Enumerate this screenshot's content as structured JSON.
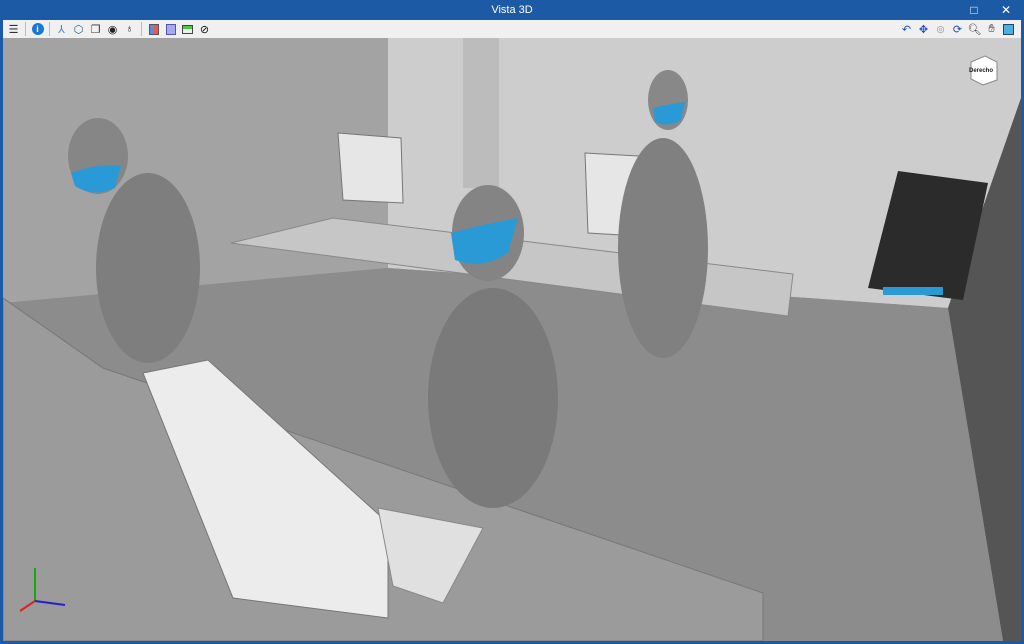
{
  "window": {
    "title": "Vista 3D",
    "maximize_icon": "□",
    "close_icon": "✕"
  },
  "toolbar": {
    "left": [
      "layers-icon",
      "info-icon",
      "axes-icon",
      "box-view-icon",
      "copy-view-icon",
      "eye-view-icon",
      "orbit-icon",
      "section-red-icon",
      "section-blue-icon",
      "section-green-icon",
      "hide-icon"
    ],
    "right": [
      "rotate-icon",
      "zoom-extents-icon",
      "zoom-previous-icon",
      "refresh-icon",
      "zoom-window-icon",
      "pan-hand-icon",
      "export-view-icon"
    ]
  },
  "viewcube": {
    "face_label": "Derecho"
  },
  "colors": {
    "titlebar": "#1c5aa6",
    "mask": "#2a9ad6",
    "scene_bg": "#8e8e8e"
  }
}
